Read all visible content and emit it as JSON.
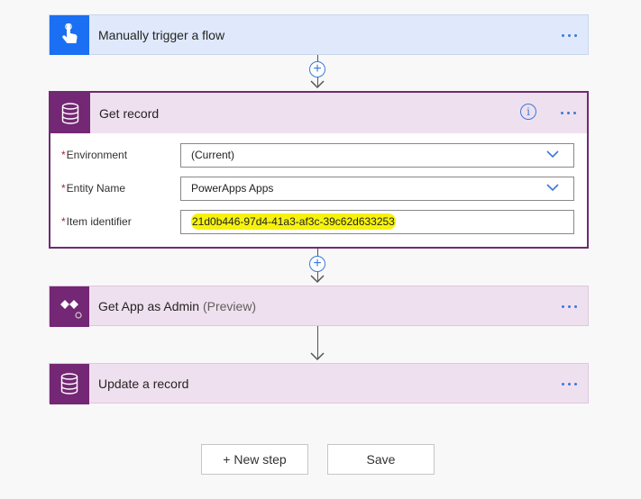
{
  "steps": {
    "trigger": {
      "title": "Manually trigger a flow",
      "icon": "touch-hand-icon",
      "color": "#1b6ff2"
    },
    "get_record": {
      "title": "Get record",
      "icon": "database-icon",
      "color": "#742774",
      "fields": [
        {
          "label": "Environment",
          "value": "(Current)",
          "type": "dropdown"
        },
        {
          "label": "Entity Name",
          "value": "PowerApps Apps",
          "type": "dropdown"
        },
        {
          "label": "Item identifier",
          "value": "21d0b446-97d4-41a3-af3c-39c62d633253",
          "type": "text",
          "highlight_color": "#f6f20f"
        }
      ]
    },
    "get_app": {
      "title": "Get App as Admin",
      "subtitle": "(Preview)",
      "icon": "powerapps-admin-icon",
      "color": "#742774"
    },
    "update": {
      "title": "Update a record",
      "icon": "database-icon",
      "color": "#742774"
    }
  },
  "required_marker": "*",
  "add_symbol": "+",
  "info_symbol": "i",
  "buttons": {
    "new_step": "+ New step",
    "save": "Save"
  }
}
